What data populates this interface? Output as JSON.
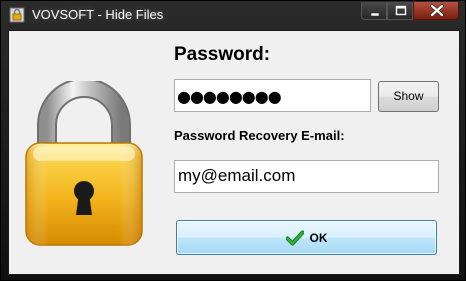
{
  "window": {
    "title": "VOVSOFT - Hide Files"
  },
  "form": {
    "password_label": "Password:",
    "password_value": "●●●●●●●●",
    "show_button_label": "Show",
    "email_label": "Password Recovery E-mail:",
    "email_value": "my@email.com",
    "ok_button_label": "OK"
  },
  "icons": {
    "app": "lock-icon",
    "main_image": "padlock-icon",
    "ok": "checkmark-icon"
  },
  "colors": {
    "accent_green": "#1e9a1e",
    "lock_gold": "#f1b21b",
    "ok_border": "#3c7fb1"
  }
}
